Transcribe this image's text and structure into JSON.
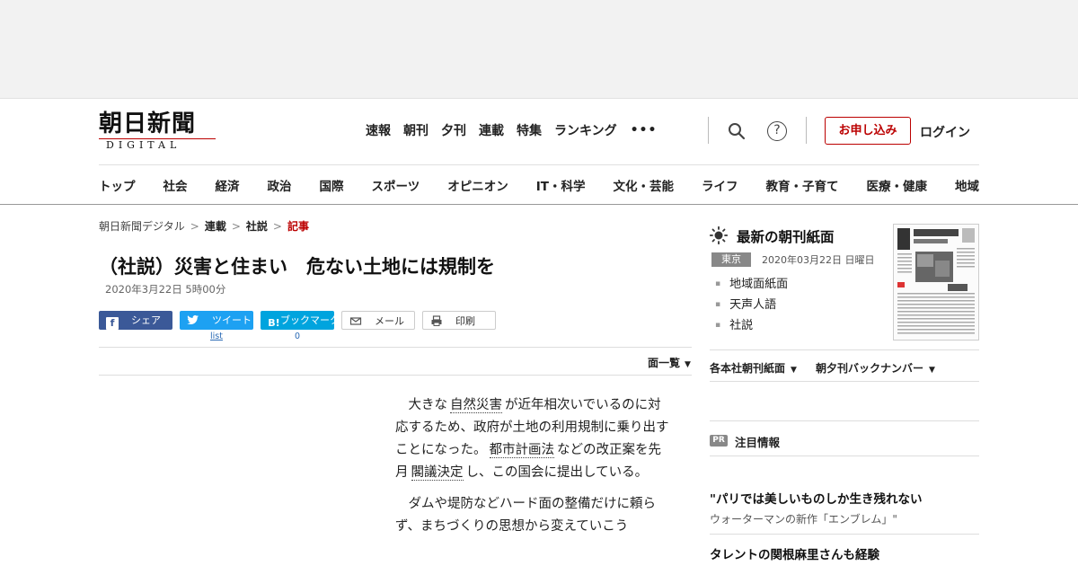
{
  "header": {
    "logo_main": "朝日新聞",
    "logo_sub": "DIGITAL",
    "top_nav": [
      "速報",
      "朝刊",
      "夕刊",
      "連載",
      "特集",
      "ランキング"
    ],
    "more": "•••",
    "help": "?",
    "apply_label": "お申し込み",
    "login_label": "ログイン"
  },
  "category_nav": [
    "トップ",
    "社会",
    "経済",
    "政治",
    "国際",
    "スポーツ",
    "オピニオン",
    "IT・科学",
    "文化・芸能",
    "ライフ",
    "教育・子育て",
    "医療・健康",
    "地域"
  ],
  "breadcrumb": [
    "朝日新聞デジタル",
    "連載",
    "社説",
    "記事"
  ],
  "article": {
    "title": "（社説）災害と住まい　危ない土地には規制を",
    "date": "2020年3月22日 5時00分",
    "share": {
      "facebook": "シェア",
      "twitter": "ツイート",
      "hatena_icon": "B!",
      "hatena": "ブックマーク",
      "mail": "メール",
      "print": "印刷",
      "twitter_count": "list",
      "hatena_count": "0"
    },
    "page_list": "面一覧",
    "p1_a": "大きな",
    "p1_kw1": "自然災害",
    "p1_b": "が近年相次いでいるのに対応するため、政府が土地の利用規制に乗り出すことになった。",
    "p1_kw2": "都市計画法",
    "p1_c": "などの改正案を先月",
    "p1_kw3": "閣議決定",
    "p1_d": "し、この国会に提出している。",
    "p2": "ダムや堤防などハード面の整備だけに頼らず、まちづくりの思想から変えていこう"
  },
  "sidebar": {
    "title": "最新の朝刊紙面",
    "region": "東京",
    "date": "2020年03月22日 日曜日",
    "links": [
      "地域面紙面",
      "天声人語",
      "社説"
    ],
    "dropdown1": "各本社朝刊紙面",
    "dropdown2": "朝夕刊バックナンバー",
    "pr_badge": "PR",
    "pr_title": "注目情報",
    "pr_items": [
      {
        "headline": "\"パリでは美しいものしか生き残れない",
        "sub": "ウォーターマンの新作「エンブレム」\""
      },
      {
        "headline": "タレントの関根麻里さんも経験"
      }
    ]
  }
}
